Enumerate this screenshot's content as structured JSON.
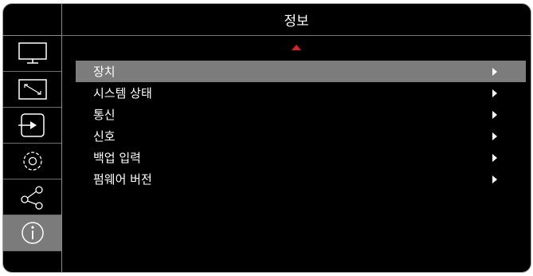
{
  "header": {
    "title": "정보"
  },
  "sidebar": {
    "items": [
      {
        "icon": "monitor-icon",
        "active": false
      },
      {
        "icon": "resize-icon",
        "active": false
      },
      {
        "icon": "input-icon",
        "active": false
      },
      {
        "icon": "settings-icon",
        "active": false
      },
      {
        "icon": "network-icon",
        "active": false
      },
      {
        "icon": "info-icon",
        "active": true
      }
    ]
  },
  "menu": {
    "items": [
      {
        "label": "장치",
        "selected": true
      },
      {
        "label": "시스템 상태",
        "selected": false
      },
      {
        "label": "통신",
        "selected": false
      },
      {
        "label": "신호",
        "selected": false
      },
      {
        "label": "백업 입력",
        "selected": false
      },
      {
        "label": "펌웨어 버전",
        "selected": false
      }
    ]
  },
  "colors": {
    "background": "#000000",
    "highlight": "#7c7c7c",
    "accent": "#e0201c"
  }
}
